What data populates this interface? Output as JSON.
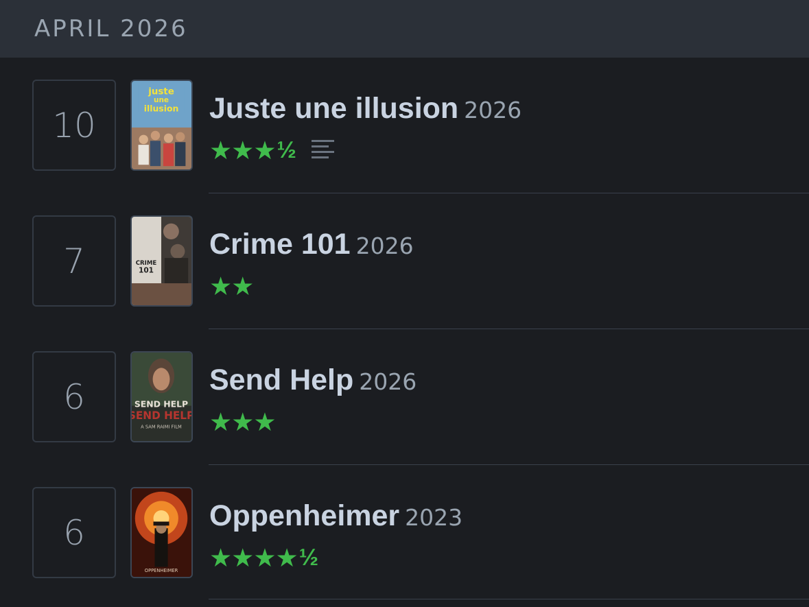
{
  "month": "APRIL 2026",
  "colors": {
    "star": "#40bb4c",
    "background": "#1b1d21",
    "header": "#2b3038"
  },
  "entries": [
    {
      "day": "10",
      "title": "Juste une illusion",
      "year": "2026",
      "stars": "★★★",
      "half": "½",
      "rating": 3.5,
      "has_review": true,
      "review_icon": "review-lines-icon"
    },
    {
      "day": "7",
      "title": "Crime 101",
      "year": "2026",
      "stars": "★★",
      "half": "",
      "rating": 2,
      "has_review": false
    },
    {
      "day": "6",
      "title": "Send Help",
      "year": "2026",
      "stars": "★★★",
      "half": "",
      "rating": 3,
      "has_review": false
    },
    {
      "day": "6",
      "title": "Oppenheimer",
      "year": "2023",
      "stars": "★★★★",
      "half": "½",
      "rating": 4.5,
      "has_review": false
    }
  ]
}
